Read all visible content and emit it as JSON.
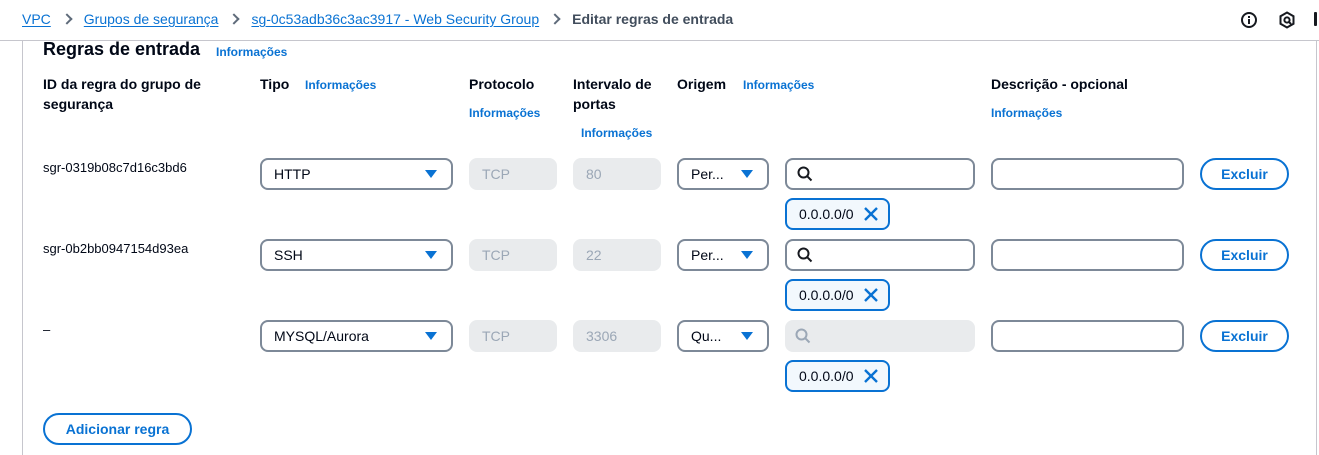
{
  "breadcrumb": {
    "items": [
      "VPC",
      "Grupos de segurança",
      "sg-0c53adb36c3ac3917 - Web Security Group"
    ],
    "current": "Editar regras de entrada"
  },
  "header_icons": [
    "info-circle-icon",
    "notifications-icon"
  ],
  "section": {
    "title": "Regras de entrada",
    "info": "Informações"
  },
  "columns": {
    "rule_id": "ID da regra do grupo de segurança",
    "type": "Tipo",
    "type_info": "Informações",
    "protocol": "Protocolo",
    "protocol_info": "Informações",
    "port_range": "Intervalo de portas",
    "port_info": "Informações",
    "source": "Origem",
    "source_info": "Informações",
    "description": "Descrição - opcional",
    "description_info": "Informações"
  },
  "rules": [
    {
      "id": "sgr-0319b08c7d16c3bd6",
      "type": "HTTP",
      "protocol": "TCP",
      "port": "80",
      "source": "Per...",
      "search_value": "",
      "cidr": "0.0.0.0/0",
      "description": "",
      "delete_label": "Excluir",
      "search_disabled": false
    },
    {
      "id": "sgr-0b2bb0947154d93ea",
      "type": "SSH",
      "protocol": "TCP",
      "port": "22",
      "source": "Per...",
      "search_value": "",
      "cidr": "0.0.0.0/0",
      "description": "",
      "delete_label": "Excluir",
      "search_disabled": false
    },
    {
      "id": "–",
      "type": "MYSQL/Aurora",
      "protocol": "TCP",
      "port": "3306",
      "source": "Qu...",
      "search_value": "",
      "cidr": "0.0.0.0/0",
      "description": "",
      "delete_label": "Excluir",
      "search_disabled": true
    }
  ],
  "add_rule_label": "Adicionar regra",
  "colors": {
    "accent": "#0972d3",
    "text": "#000716",
    "border": "#7d8998",
    "disabled_bg": "#e9ebed"
  }
}
